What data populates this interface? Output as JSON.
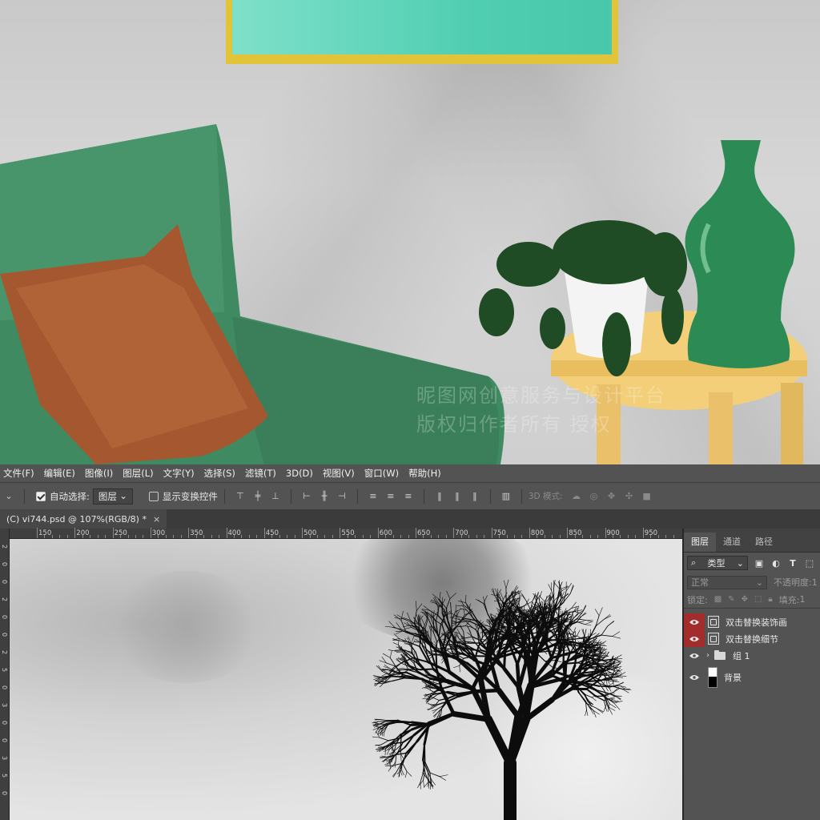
{
  "menu": [
    "文件(F)",
    "编辑(E)",
    "图像(I)",
    "图层(L)",
    "文字(Y)",
    "选择(S)",
    "滤镜(T)",
    "3D(D)",
    "视图(V)",
    "窗口(W)",
    "帮助(H)"
  ],
  "options": {
    "auto_select_label": "自动选择:",
    "auto_select_value": "图层",
    "show_transform_label": "显示变换控件",
    "mode_3d_label": "3D 模式:"
  },
  "document_tab": {
    "title": "(C) vi744.psd @ 107%(RGB/8) *",
    "close": "×"
  },
  "ruler_h": [
    "150",
    "200",
    "250",
    "300",
    "350",
    "400",
    "450",
    "500",
    "550",
    "600",
    "650",
    "700",
    "750",
    "800",
    "850",
    "900",
    "950"
  ],
  "ruler_v": [
    "2",
    "0",
    "0",
    "2",
    "0",
    "0",
    "2",
    "5",
    "0",
    "3",
    "0",
    "0",
    "3",
    "5",
    "0"
  ],
  "watermark": {
    "line1": "昵图网创意服务与设计平台",
    "line2": "版权归作者所有 授权"
  },
  "panel": {
    "tabs": [
      "图层",
      "通道",
      "路径"
    ],
    "filter_label": "类型",
    "blend_mode": "正常",
    "opacity_label": "不透明度:",
    "opacity_value": "1",
    "lock_label": "锁定:",
    "fill_label": "填充:",
    "fill_value": "1",
    "layers": [
      {
        "name": "双击替换装饰画",
        "type": "smart",
        "eye_highlight": true
      },
      {
        "name": "双击替换细节",
        "type": "smart",
        "eye_highlight": true
      },
      {
        "name": "组 1",
        "type": "group",
        "eye_highlight": false
      },
      {
        "name": "背景",
        "type": "background",
        "eye_highlight": false
      }
    ]
  },
  "icons": {
    "search": "search-icon",
    "eye": "eye-icon",
    "folder": "folder-icon"
  }
}
